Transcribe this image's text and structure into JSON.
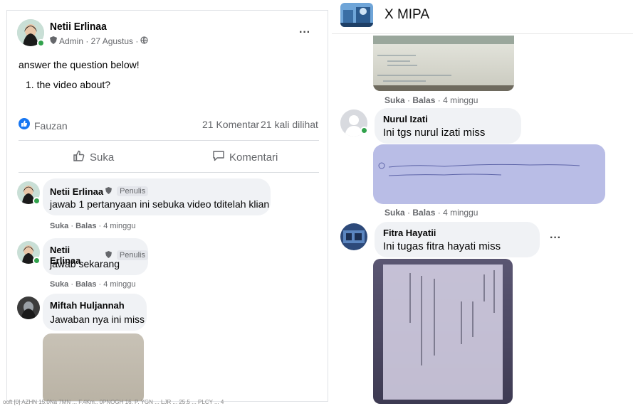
{
  "left": {
    "post": {
      "author": "Netii Erlinaa",
      "meta": "Admin · 27 Agustus ·",
      "more": "···",
      "line1": "answer the question below!",
      "line2": "1. the video about?"
    },
    "stats": {
      "reactor": "Fauzan",
      "comments": "21 Komentar",
      "views": "21 kali dilihat"
    },
    "actions": {
      "like": "Suka",
      "comment": "Komentari"
    },
    "comments": [
      {
        "name": "Netii Erlinaa",
        "badge": "Penulis",
        "text": "jawab 1 pertanyaan ini sebuka video tditelah klian",
        "like": "Suka",
        "reply": "Balas",
        "time": "4 minggu"
      },
      {
        "name": "Netii Erlinaa",
        "badge": "Penulis",
        "text": "jawab sekarang",
        "like": "Suka",
        "reply": "Balas",
        "time": "4 minggu"
      },
      {
        "name": "Miftah Huljannah",
        "text": "Jawaban nya ini miss"
      }
    ],
    "footer_strip": "ooft  [0]  AZHN  15.0Na  7MN  ...  F.4Km..  0PNOGH  16. P.  YGN  ...  LJR  ...  25.5  ...  PLCY  ...  4"
  },
  "right": {
    "group_title": "X MIPA",
    "first_meta": {
      "like": "Suka",
      "reply": "Balas",
      "time": "4 minggu"
    },
    "comments": [
      {
        "name": "Nurul Izati",
        "text": "Ini tgs nurul izati miss",
        "like": "Suka",
        "reply": "Balas",
        "time": "4 minggu"
      },
      {
        "name": "Fitra Hayatii",
        "text": "Ini tugas fitra hayati miss",
        "more": "···"
      }
    ]
  },
  "colors": {
    "like_blue": "#1877f2",
    "online_green": "#31a24c",
    "bubble_gray": "#f0f2f5",
    "meta_gray": "#65676b"
  }
}
